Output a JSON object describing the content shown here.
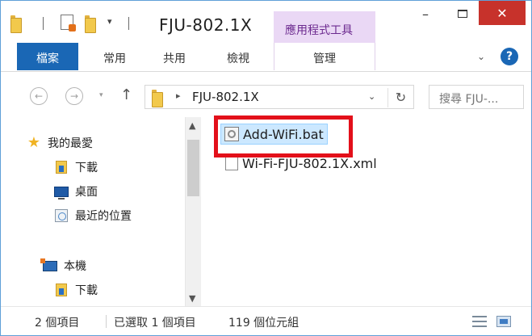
{
  "window": {
    "title": "FJU-802.1X",
    "contextual_tab": "應用程式工具",
    "minimize_glyph": "–",
    "close_glyph": "✕",
    "quick_access_dropdown": "▾"
  },
  "ribbon": {
    "tabs": [
      {
        "label": "檔案",
        "active": true
      },
      {
        "label": "常用"
      },
      {
        "label": "共用"
      },
      {
        "label": "檢視"
      },
      {
        "label": "管理"
      }
    ],
    "collapse_glyph": "⌄",
    "help_glyph": "?"
  },
  "address": {
    "back_glyph": "←",
    "forward_glyph": "→",
    "recent_glyph": "▾",
    "up_glyph": "↑",
    "breadcrumb_arrow": "▸",
    "path": "FJU-802.1X",
    "dropdown_glyph": "⌄",
    "refresh_glyph": "↻",
    "search_placeholder": "搜尋 FJU-..."
  },
  "nav_pane": {
    "items": [
      {
        "label": "我的最愛",
        "icon": "star-icon"
      },
      {
        "label": "下載",
        "icon": "downloads-folder-icon"
      },
      {
        "label": "桌面",
        "icon": "desktop-icon"
      },
      {
        "label": "最近的位置",
        "icon": "recent-places-icon"
      },
      {
        "label": "本機",
        "icon": "this-pc-icon"
      },
      {
        "label": "下載",
        "icon": "downloads-folder-icon"
      }
    ],
    "scroll_up_glyph": "▲",
    "scroll_down_glyph": "▼"
  },
  "files": [
    {
      "name": "Add-WiFi.bat",
      "icon": "batch-file-icon",
      "selected": true
    },
    {
      "name": "Wi-Fi-FJU-802.1X.xml",
      "icon": "xml-file-icon",
      "selected": false
    }
  ],
  "status": {
    "item_count": "2 個項目",
    "selected": "已選取 1 個項目",
    "size": "119 個位元組"
  },
  "colors": {
    "accent": "#1a67b5",
    "contextual_tab_bg": "#ead8f5",
    "contextual_tab_text": "#6c2a8f",
    "close_button": "#c7322b",
    "selection_bg": "#cce8ff",
    "highlight_border": "#e3101a"
  }
}
